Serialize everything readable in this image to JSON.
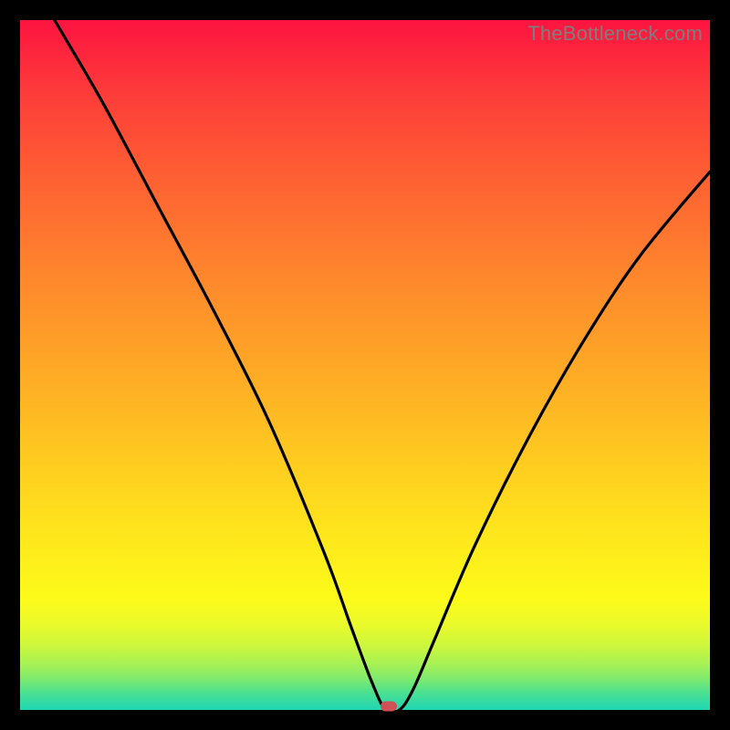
{
  "watermark_text": "TheBottleneck.com",
  "chart_data": {
    "type": "line",
    "title": "",
    "xlabel": "",
    "ylabel": "",
    "xlim": [
      0,
      100
    ],
    "ylim": [
      0,
      100
    ],
    "series": [
      {
        "name": "bottleneck-curve",
        "x": [
          5,
          12,
          20,
          28,
          36,
          44,
          48,
          51,
          53,
          55,
          57,
          60,
          66,
          74,
          82,
          90,
          100
        ],
        "values": [
          100,
          88,
          73,
          58,
          42,
          23,
          12,
          4,
          0,
          0,
          3,
          10,
          24,
          40,
          54,
          66,
          78
        ]
      }
    ],
    "minimum_marker": {
      "x": 53.5,
      "y": 0
    },
    "background_gradient": {
      "top": "#fd1440",
      "middle": "#fee51c",
      "bottom": "#1fd6b3"
    }
  },
  "minimum_marker_color": "#cf5155"
}
